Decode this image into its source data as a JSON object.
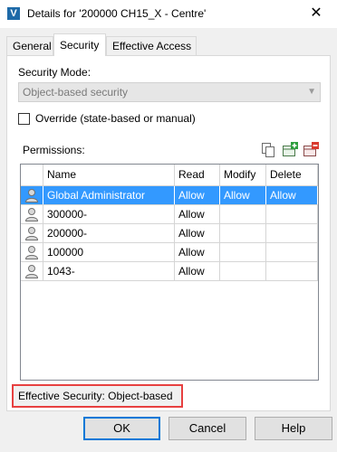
{
  "window": {
    "app_icon_letter": "V",
    "title": "Details for '200000 CH15_X - Centre'",
    "close_glyph": "✕"
  },
  "tabs": [
    {
      "label": "General"
    },
    {
      "label": "Security",
      "active": true
    },
    {
      "label": "Effective Access"
    }
  ],
  "security": {
    "mode_label": "Security Mode:",
    "mode_value": "Object-based security",
    "override_label": "Override (state-based or manual)",
    "override_checked": false,
    "permissions_label": "Permissions:"
  },
  "toolbar_icons": [
    "copy-icon",
    "add-user-icon",
    "remove-user-icon"
  ],
  "permissions_table": {
    "headers": {
      "name": "Name",
      "read": "Read",
      "modify": "Modify",
      "delete": "Delete"
    },
    "rows": [
      {
        "name": "Global Administrator",
        "read": "Allow",
        "modify": "Allow",
        "delete": "Allow",
        "selected": true
      },
      {
        "name": "300000-",
        "read": "Allow",
        "modify": "",
        "delete": ""
      },
      {
        "name": "200000-",
        "read": "Allow",
        "modify": "",
        "delete": ""
      },
      {
        "name": "100000",
        "read": "Allow",
        "modify": "",
        "delete": ""
      },
      {
        "name": "1043-",
        "read": "Allow",
        "modify": "",
        "delete": ""
      }
    ]
  },
  "status": {
    "effective_security": "Effective Security: Object-based"
  },
  "buttons": {
    "ok": "OK",
    "cancel": "Cancel",
    "help": "Help"
  },
  "colors": {
    "selection": "#3399ff",
    "highlight_border": "#e74040",
    "default_button_border": "#0078d7"
  }
}
